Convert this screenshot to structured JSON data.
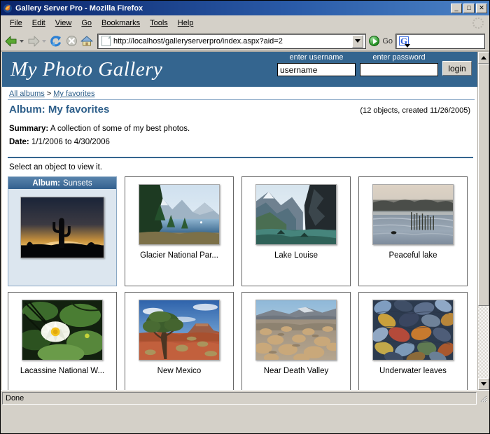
{
  "window": {
    "title": "Gallery Server Pro - Mozilla Firefox",
    "app_icon": "firefox-icon",
    "minimize_label": "_",
    "maximize_label": "□",
    "close_label": "✕"
  },
  "menubar": {
    "items": [
      {
        "label": "File"
      },
      {
        "label": "Edit"
      },
      {
        "label": "View"
      },
      {
        "label": "Go"
      },
      {
        "label": "Bookmarks"
      },
      {
        "label": "Tools"
      },
      {
        "label": "Help"
      }
    ]
  },
  "toolbar": {
    "back_icon": "back-arrow-icon",
    "forward_icon": "forward-arrow-icon",
    "reload_icon": "reload-icon",
    "stop_icon": "stop-icon",
    "home_icon": "home-icon",
    "url": "http://localhost/galleryserverpro/index.aspx?aid=2",
    "url_placeholder": "Enter address",
    "go_label": "Go",
    "search_value": "",
    "search_placeholder": "",
    "search_engine_icon": "google-g-icon"
  },
  "gallery": {
    "site_title": "My Photo Gallery",
    "login": {
      "username_label": "enter username",
      "password_label": "enter password",
      "username_value": "username",
      "username_placeholder": "username",
      "password_value": "",
      "password_placeholder": "",
      "login_button": "login"
    },
    "breadcrumb": {
      "root": "All albums",
      "separator": ">",
      "current": "My favorites"
    },
    "album_title": "Album: My favorites",
    "album_meta": "(12 objects, created 11/26/2005)",
    "summary_label": "Summary:",
    "summary_value": "A collection of some of my best photos.",
    "date_label": "Date:",
    "date_value": "1/1/2006 to 4/30/2006",
    "instruction": "Select an object to view it.",
    "items": [
      {
        "kind": "album",
        "head_label": "Album:",
        "head_value": "Sunsets",
        "caption": "",
        "thumb": "sunset-cactus"
      },
      {
        "kind": "media",
        "caption": "Glacier National Par...",
        "thumb": "glacier-lake"
      },
      {
        "kind": "media",
        "caption": "Lake Louise",
        "thumb": "lake-louise"
      },
      {
        "kind": "media",
        "caption": "Peaceful lake",
        "thumb": "peaceful-lake"
      },
      {
        "kind": "media",
        "caption": "Lacassine National W...",
        "thumb": "water-lily"
      },
      {
        "kind": "media",
        "caption": "New Mexico",
        "thumb": "new-mexico"
      },
      {
        "kind": "media",
        "caption": "Near Death Valley",
        "thumb": "death-valley"
      },
      {
        "kind": "media",
        "caption": "Underwater leaves",
        "thumb": "underwater-leaves"
      }
    ]
  },
  "statusbar": {
    "text": "Done"
  },
  "colors": {
    "header_blue": "#34658f",
    "link_blue": "#2e5f8a",
    "tile_album_bg": "#dce6ef",
    "chrome_gray": "#d4d0c8",
    "titlebar_blue": "#0a246a"
  }
}
